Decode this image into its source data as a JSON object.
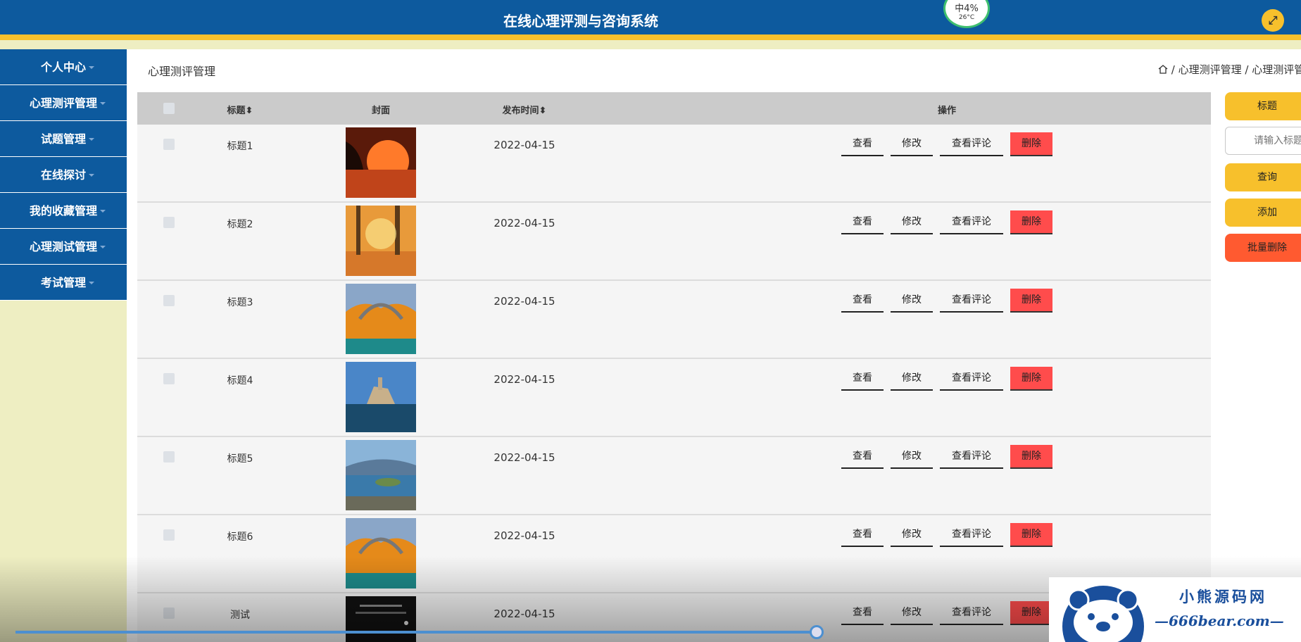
{
  "header": {
    "title": "在线心理评测与咨询系统",
    "weather_pct": "中4%",
    "weather_temp": "26°C"
  },
  "sidebar": {
    "items": [
      {
        "label": "个人中心"
      },
      {
        "label": "心理测评管理"
      },
      {
        "label": "试题管理"
      },
      {
        "label": "在线探讨"
      },
      {
        "label": "我的收藏管理"
      },
      {
        "label": "心理测试管理"
      },
      {
        "label": "考试管理"
      }
    ]
  },
  "main": {
    "page_title": "心理测评管理",
    "breadcrumb": "/ 心理测评管理 / 心理测评管理"
  },
  "table": {
    "headers": {
      "title": "标题",
      "cover": "封面",
      "time": "发布时间",
      "actions": "操作"
    },
    "rows": [
      {
        "title": "标题1",
        "time": "2022-04-15",
        "cover": "sunset-lake-image"
      },
      {
        "title": "标题2",
        "time": "2022-04-15",
        "cover": "autumn-forest-image"
      },
      {
        "title": "标题3",
        "time": "2022-04-15",
        "cover": "bridge-autumn-image"
      },
      {
        "title": "标题4",
        "time": "2022-04-15",
        "cover": "island-castle-image"
      },
      {
        "title": "标题5",
        "time": "2022-04-15",
        "cover": "lake-peninsula-image"
      },
      {
        "title": "标题6",
        "time": "2022-04-15",
        "cover": "bridge-autumn-image"
      },
      {
        "title": "测试",
        "time": "2022-04-15",
        "cover": "dark-text-image"
      }
    ],
    "actions": {
      "view": "查看",
      "edit": "修改",
      "comment": "查看评论",
      "delete": "删除"
    }
  },
  "search": {
    "title_label": "标题",
    "placeholder": "请输入标题",
    "query_label": "查询",
    "add_label": "添加",
    "batch_delete_label": "批量删除"
  },
  "watermark": {
    "cn": "小熊源码网",
    "en": "—666bear.com—"
  },
  "colors": {
    "header": "#0d5a9e",
    "accent": "#f7c02c",
    "delete": "#ff4c4c",
    "sidebar_bg": "#eeeec2"
  }
}
